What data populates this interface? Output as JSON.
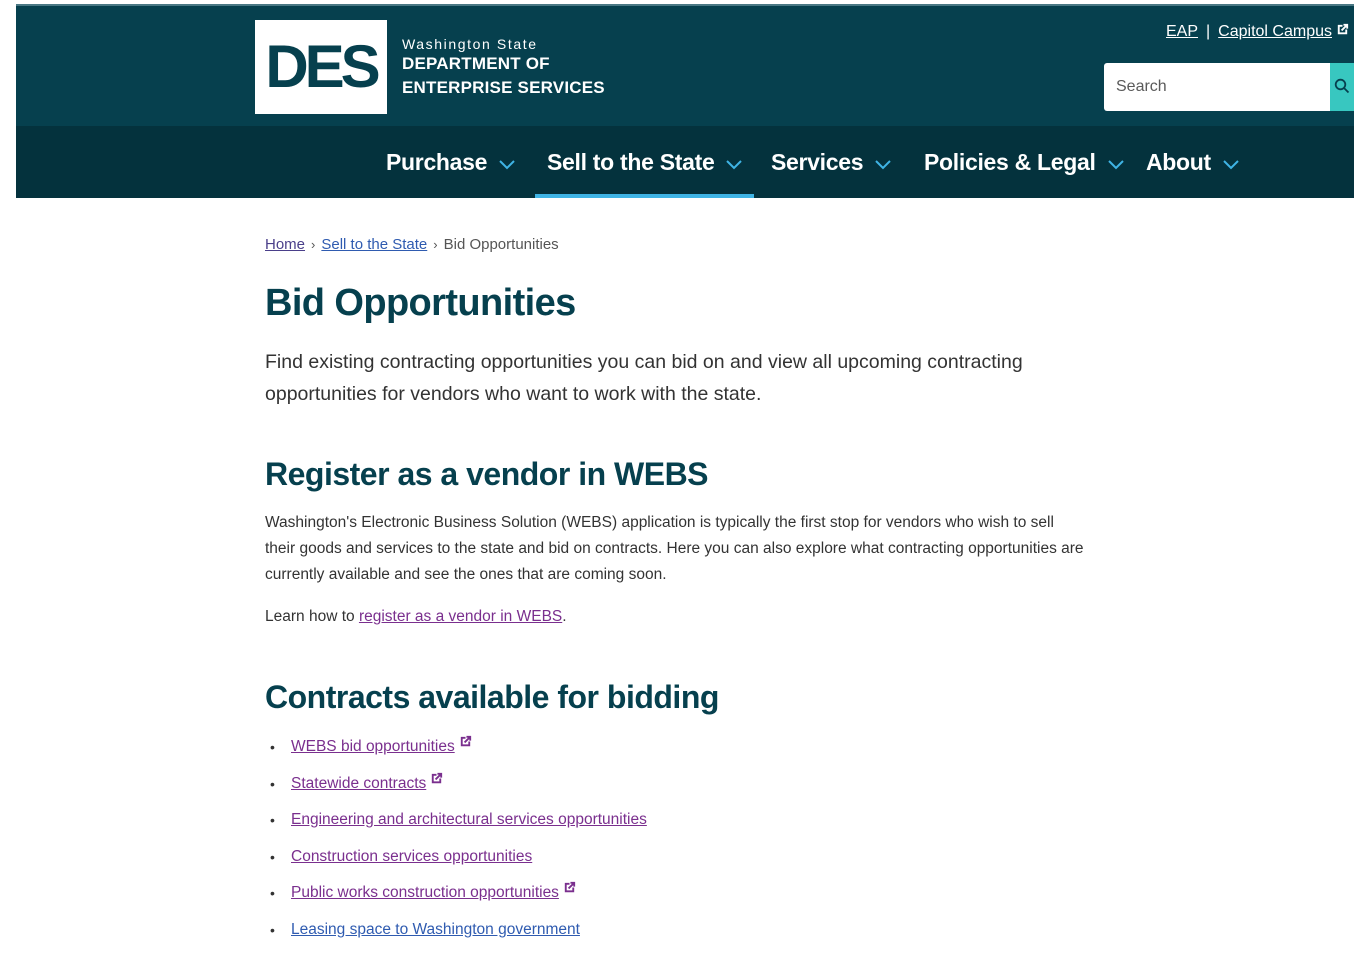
{
  "header": {
    "logo_text": "DES",
    "agency_state": "Washington State",
    "agency_line1": "DEPARTMENT OF",
    "agency_line2": "ENTERPRISE SERVICES",
    "util_links": {
      "eap": "EAP",
      "separator": "|",
      "capitol": "Capitol Campus"
    },
    "search": {
      "placeholder": "Search",
      "value": ""
    }
  },
  "nav": {
    "items": [
      {
        "label": "Purchase"
      },
      {
        "label": "Sell to the State"
      },
      {
        "label": "Services"
      },
      {
        "label": "Policies & Legal"
      },
      {
        "label": "About"
      }
    ]
  },
  "breadcrumb": {
    "home": "Home",
    "parent": "Sell to the State",
    "current": "Bid Opportunities"
  },
  "main": {
    "title": "Bid Opportunities",
    "intro": "Find existing contracting opportunities you can bid on and view all upcoming contracting opportunities for vendors who want to work with the state.",
    "register": {
      "heading": "Register as a vendor in WEBS",
      "body": "Washington's Electronic Business Solution (WEBS) application is typically the first stop for vendors who wish to sell their goods and services to the state and bid on contracts. Here you can also explore what contracting opportunities are currently available and see the ones that are coming soon.",
      "learn_prefix": "Learn how to ",
      "learn_link": "register as a vendor in WEBS",
      "learn_suffix": "."
    },
    "contracts": {
      "heading": "Contracts available for bidding",
      "items": [
        {
          "label": "WEBS bid opportunities",
          "external": true
        },
        {
          "label": "Statewide contracts",
          "external": true
        },
        {
          "label": "Engineering and architectural services opportunities",
          "external": false
        },
        {
          "label": "Construction services opportunities",
          "external": false
        },
        {
          "label": "Public works construction opportunities",
          "external": true
        },
        {
          "label": "Leasing space to Washington government",
          "external": false
        }
      ]
    }
  },
  "colors": {
    "header_bg": "#06404e",
    "nav_bg": "#04323d",
    "accent_teal": "#38c7c0",
    "active_underline": "#3fb4e5",
    "heading": "#06404e",
    "visited_link": "#7a2f8e",
    "link": "#2f5bb0"
  }
}
